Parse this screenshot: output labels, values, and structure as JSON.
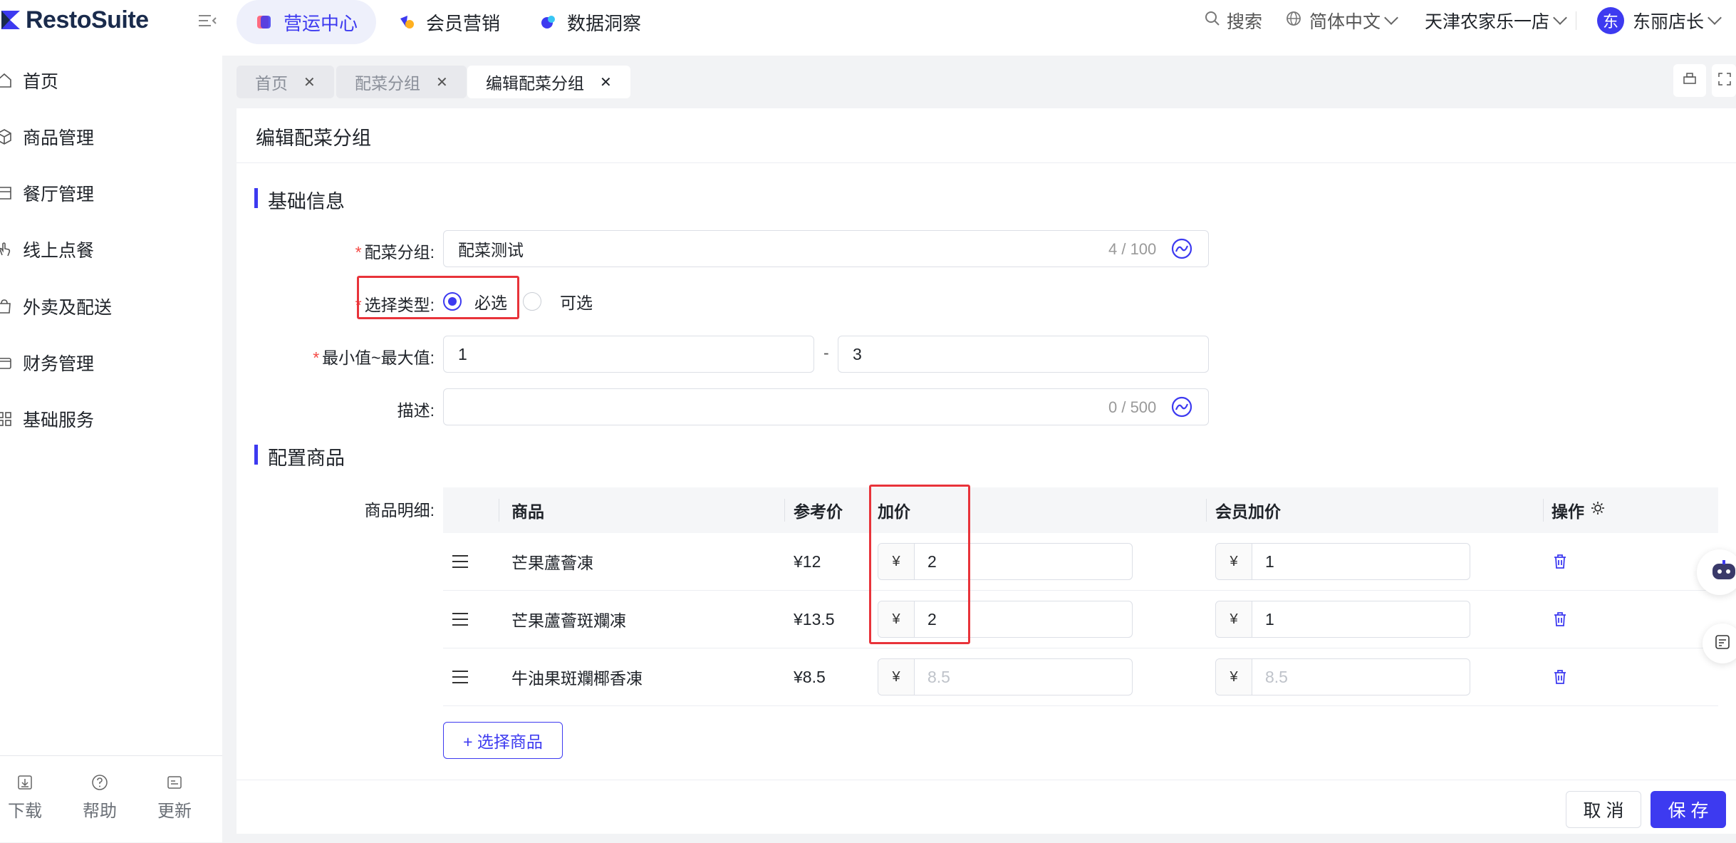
{
  "brand": {
    "name": "RestoSuite",
    "accent": "#3d3af0"
  },
  "top_nav": [
    {
      "label": "营运中心",
      "icon": "operation-center-icon",
      "active": true
    },
    {
      "label": "会员营销",
      "icon": "member-marketing-icon",
      "active": false
    },
    {
      "label": "数据洞察",
      "icon": "data-insight-icon",
      "active": false
    }
  ],
  "top_right": {
    "search": "搜索",
    "language": "简体中文",
    "store": "天津农家乐一店",
    "avatar_char": "东",
    "user": "东丽店长"
  },
  "sidebar": {
    "items": [
      {
        "label": "首页",
        "icon": "home-icon"
      },
      {
        "label": "商品管理",
        "icon": "box-icon"
      },
      {
        "label": "餐厅管理",
        "icon": "store-icon"
      },
      {
        "label": "线上点餐",
        "icon": "hand-tap-icon"
      },
      {
        "label": "外卖及配送",
        "icon": "bag-icon"
      },
      {
        "label": "财务管理",
        "icon": "wallet-icon"
      },
      {
        "label": "基础服务",
        "icon": "grid-icon"
      }
    ],
    "bottom": [
      {
        "label": "下载",
        "icon": "download-icon"
      },
      {
        "label": "帮助",
        "icon": "help-icon"
      },
      {
        "label": "更新",
        "icon": "update-icon"
      }
    ]
  },
  "page_tabs": [
    {
      "label": "首页",
      "active": false
    },
    {
      "label": "配菜分组",
      "active": false
    },
    {
      "label": "编辑配菜分组",
      "active": true
    }
  ],
  "page": {
    "title": "编辑配菜分组",
    "section_basic": "基础信息",
    "section_config": "配置商品",
    "form": {
      "group_label": "配菜分组:",
      "group_value": "配菜测试",
      "group_counter": "4 / 100",
      "type_label": "选择类型:",
      "type_required": "必选",
      "type_optional": "可选",
      "range_label": "最小值~最大值:",
      "min": "1",
      "range_sep": "-",
      "max": "3",
      "desc_label": "描述:",
      "desc_value": "",
      "desc_counter": "0 / 500"
    },
    "table": {
      "row_label": "商品明细:",
      "headers": {
        "product": "商品",
        "ref_price": "参考价",
        "add_price": "加价",
        "member_price": "会员加价",
        "action": "操作"
      },
      "currency": "¥",
      "rows": [
        {
          "product": "芒果蘆薈凍",
          "ref_price": "¥12",
          "add_price": "2",
          "member_price": "1",
          "placeholder": false
        },
        {
          "product": "芒果蘆薈斑斕凍",
          "ref_price": "¥13.5",
          "add_price": "2",
          "member_price": "1",
          "placeholder": false
        },
        {
          "product": "牛油果斑斕椰香凍",
          "ref_price": "¥8.5",
          "add_price": "8.5",
          "member_price": "8.5",
          "placeholder": true
        }
      ]
    },
    "select_button": "+ 选择商品",
    "cancel_button": "取 消",
    "save_button": "保 存"
  }
}
